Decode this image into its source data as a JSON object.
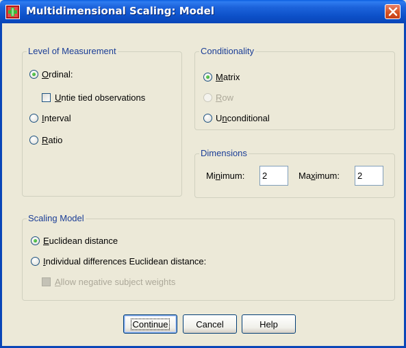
{
  "window": {
    "title": "Multidimensional Scaling: Model",
    "titlebar_color": "#0a50c8"
  },
  "level_of_measurement": {
    "legend": "Level of Measurement",
    "options": [
      {
        "key": "ordinal",
        "mnemonic": "O",
        "rest": "rdinal:",
        "checked": true
      },
      {
        "key": "interval",
        "mnemonic": "I",
        "rest": "nterval",
        "checked": false
      },
      {
        "key": "ratio",
        "mnemonic": "R",
        "rest": "atio",
        "checked": false
      }
    ],
    "untie": {
      "pre": "",
      "mnemonic": "U",
      "rest": "ntie tied observations",
      "checked": false
    }
  },
  "conditionality": {
    "legend": "Conditionality",
    "options": [
      {
        "key": "matrix",
        "mnemonic": "M",
        "rest": "atrix",
        "checked": true,
        "enabled": true
      },
      {
        "key": "row",
        "mnemonic": "R",
        "rest": "ow",
        "checked": false,
        "enabled": false
      },
      {
        "key": "unconditional",
        "mnemonic": "n",
        "pre": "U",
        "rest": "conditional",
        "checked": false,
        "enabled": true
      }
    ]
  },
  "dimensions": {
    "legend": "Dimensions",
    "min_label_pre": "Mi",
    "min_label_mnemonic": "n",
    "min_label_rest": "imum:",
    "min_value": "2",
    "max_label_pre": "Ma",
    "max_label_mnemonic": "x",
    "max_label_rest": "imum:",
    "max_value": "2"
  },
  "scaling_model": {
    "legend": "Scaling Model",
    "euclidean": {
      "mnemonic": "E",
      "rest": "uclidean distance",
      "checked": true
    },
    "individual": {
      "mnemonic": "I",
      "rest": "ndividual differences Euclidean distance:",
      "checked": false
    },
    "allow_negative": {
      "mnemonic": "A",
      "rest": "llow negative subject weights",
      "checked": false,
      "enabled": false
    }
  },
  "buttons": {
    "continue": "Continue",
    "cancel": "Cancel",
    "help": "Help"
  }
}
